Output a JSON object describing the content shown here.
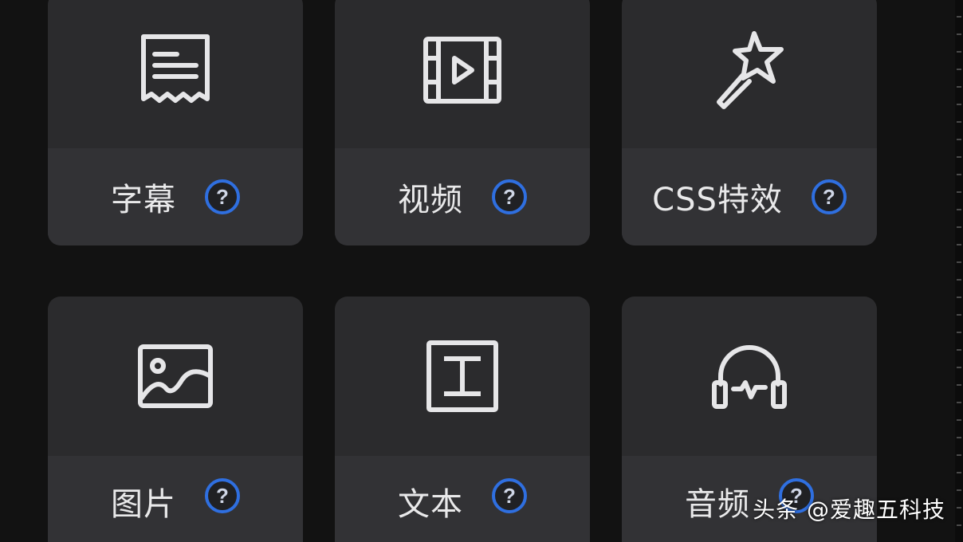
{
  "tiles": [
    {
      "label": "字幕",
      "icon": "subtitle-receipt-icon"
    },
    {
      "label": "视频",
      "icon": "video-film-icon"
    },
    {
      "label": "CSS特效",
      "icon": "magic-wand-icon"
    },
    {
      "label": "图片",
      "icon": "image-icon"
    },
    {
      "label": "文本",
      "icon": "text-icon"
    },
    {
      "label": "音频",
      "icon": "headphones-icon"
    }
  ],
  "help_glyph": "?",
  "watermark": "头条 @爱趣五科技",
  "colors": {
    "background": "#121212",
    "tile": "#2b2b2d",
    "label_bar": "#323235",
    "help_ring": "#2f6fe0",
    "icon_stroke": "#e6e6e8"
  }
}
